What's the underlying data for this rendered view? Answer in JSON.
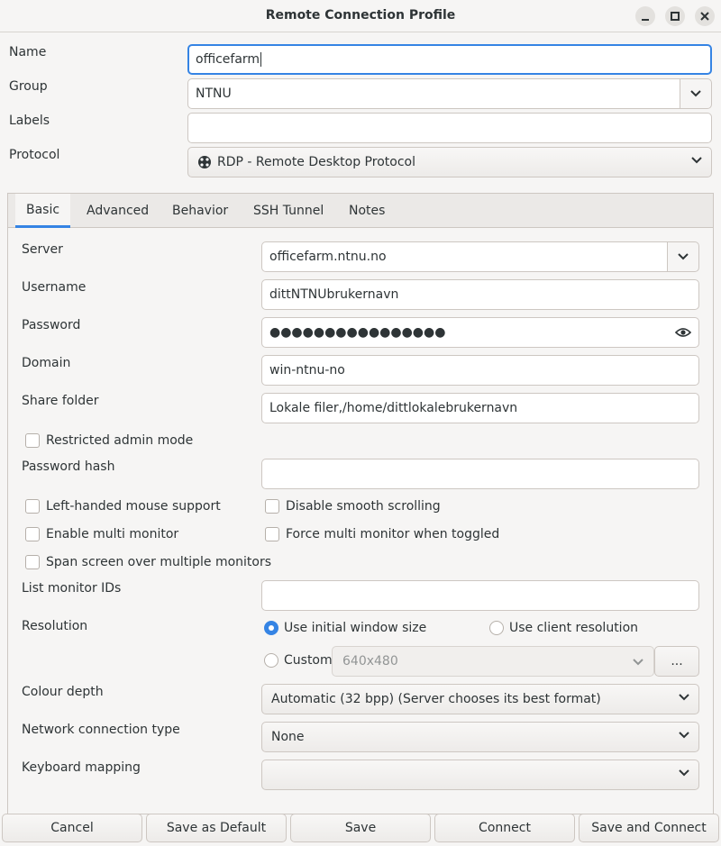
{
  "window": {
    "title": "Remote Connection Profile",
    "minimize_icon": "minimize-icon",
    "maximize_icon": "maximize-icon",
    "close_icon": "close-icon"
  },
  "profile": {
    "name_label": "Name",
    "name_value": "officefarm",
    "group_label": "Group",
    "group_value": "NTNU",
    "labels_label": "Labels",
    "labels_value": "",
    "protocol_label": "Protocol",
    "protocol_value": "RDP - Remote Desktop Protocol",
    "protocol_icon": "rdp-protocol-icon"
  },
  "tabs": [
    {
      "label": "Basic",
      "active": true
    },
    {
      "label": "Advanced",
      "active": false
    },
    {
      "label": "Behavior",
      "active": false
    },
    {
      "label": "SSH Tunnel",
      "active": false
    },
    {
      "label": "Notes",
      "active": false
    }
  ],
  "basic": {
    "server_label": "Server",
    "server_value": "officefarm.ntnu.no",
    "username_label": "Username",
    "username_value": "dittNTNUbrukernavn",
    "password_label": "Password",
    "password_masked": "●●●●●●●●●●●●●●●●",
    "password_reveal_icon": "eye-icon",
    "domain_label": "Domain",
    "domain_value": "win-ntnu-no",
    "share_folder_label": "Share folder",
    "share_folder_value": "Lokale filer,/home/dittlokalebrukernavn",
    "restricted_admin_label": "Restricted admin mode",
    "restricted_admin_checked": false,
    "password_hash_label": "Password hash",
    "password_hash_value": "",
    "left_handed_label": "Left-handed mouse support",
    "left_handed_checked": false,
    "disable_smooth_label": "Disable smooth scrolling",
    "disable_smooth_checked": false,
    "multi_monitor_label": "Enable multi monitor",
    "multi_monitor_checked": false,
    "force_multi_label": "Force multi monitor when toggled",
    "force_multi_checked": false,
    "span_screen_label": "Span screen over multiple monitors",
    "span_screen_checked": false,
    "monitor_ids_label": "List monitor IDs",
    "monitor_ids_value": "",
    "resolution_label": "Resolution",
    "res_initial_label": "Use initial window size",
    "res_initial_selected": true,
    "res_client_label": "Use client resolution",
    "res_custom_label": "Custom",
    "res_custom_value": "640x480",
    "res_custom_more": "...",
    "colour_depth_label": "Colour depth",
    "colour_depth_value": "Automatic (32 bpp) (Server chooses its best format)",
    "network_type_label": "Network connection type",
    "network_type_value": "None",
    "keyboard_label": "Keyboard mapping",
    "keyboard_value": ""
  },
  "footer": {
    "cancel": "Cancel",
    "save_default": "Save as Default",
    "save": "Save",
    "connect": "Connect",
    "save_connect": "Save and Connect"
  },
  "colors": {
    "accent": "#3584e4",
    "background": "#f6f5f4"
  }
}
